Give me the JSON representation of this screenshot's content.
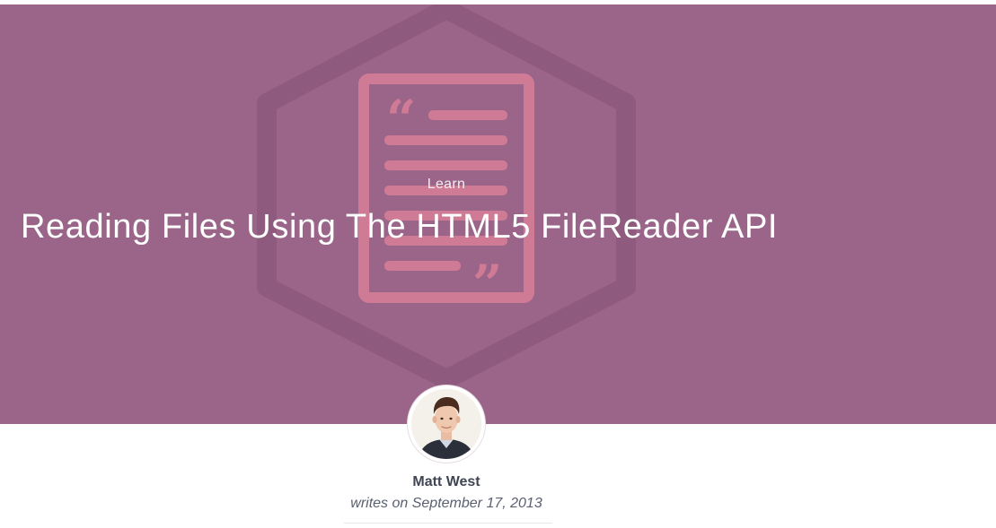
{
  "hero": {
    "background_color": "#9a6589",
    "illustration": "quote-document-hexagon-icon",
    "category": "Learn",
    "title": "Reading Files Using The HTML5 FileReader API"
  },
  "author": {
    "avatar": "author-avatar",
    "name": "Matt West",
    "byline": "writes on September 17, 2013"
  }
}
